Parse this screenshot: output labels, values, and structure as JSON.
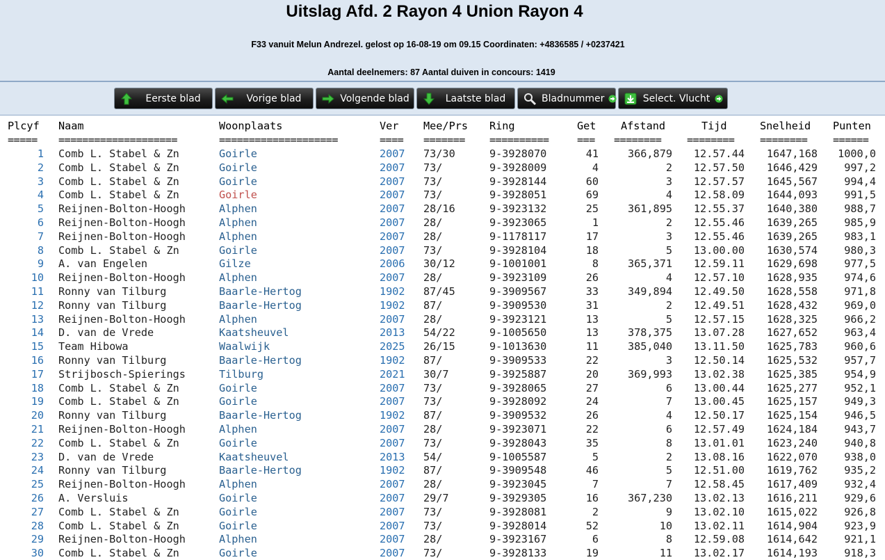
{
  "header": {
    "title": "Uitslag Afd. 2 Rayon 4 Union Rayon 4",
    "subtitle": "F33 vanuit Melun Andrezel. gelost op 16-08-19 om 09.15 Coordinaten: +4836585 / +0237421",
    "stats": "Aantal deelnemers: 87 Aantal duiven in concours: 1419"
  },
  "nav": {
    "first": "Eerste blad",
    "prev": "Vorige blad",
    "next": "Volgende blad",
    "last": "Laatste blad",
    "page": "Bladnummer",
    "select": "Select. Vlucht"
  },
  "columns": [
    "Plcyf",
    "Naam",
    "Woonplaats",
    "Ver",
    "Mee/Prs",
    "Ring",
    "Get",
    "Afstand",
    "Tijd",
    "Snelheid",
    "Punten"
  ],
  "separators": [
    "=====",
    "====================",
    "====================",
    "====",
    "=======",
    "==========",
    "===",
    "========",
    "========",
    "========",
    "======"
  ],
  "colors": {
    "link": "#2a6fb0",
    "woonplaats": "#2a6090",
    "highlight": "#c0504d",
    "header_bg": "#dde7f2"
  },
  "rows": [
    {
      "plcyf": "1",
      "naam": "Comb L. Stabel & Zn",
      "woonplaats": "Goirle",
      "ver": "2007",
      "meeprs": "73/30",
      "ring": "9-3928070",
      "get": "41",
      "afstand": "366,879",
      "tijd": "12.57.44",
      "snelheid": "1647,168",
      "punten": "1000,0"
    },
    {
      "plcyf": "2",
      "naam": "Comb L. Stabel & Zn",
      "woonplaats": "Goirle",
      "ver": "2007",
      "meeprs": "73/",
      "ring": "9-3928009",
      "get": "4",
      "afstand": "2",
      "tijd": "12.57.50",
      "snelheid": "1646,429",
      "punten": "997,2"
    },
    {
      "plcyf": "3",
      "naam": "Comb L. Stabel & Zn",
      "woonplaats": "Goirle",
      "ver": "2007",
      "meeprs": "73/",
      "ring": "9-3928144",
      "get": "60",
      "afstand": "3",
      "tijd": "12.57.57",
      "snelheid": "1645,567",
      "punten": "994,4"
    },
    {
      "plcyf": "4",
      "naam": "Comb L. Stabel & Zn",
      "woonplaats": "Goirle",
      "ver": "2007",
      "meeprs": "73/",
      "ring": "9-3928051",
      "get": "69",
      "afstand": "4",
      "tijd": "12.58.09",
      "snelheid": "1644,093",
      "punten": "991,5",
      "highlight": true
    },
    {
      "plcyf": "5",
      "naam": "Reijnen-Bolton-Hoogh",
      "woonplaats": "Alphen",
      "ver": "2007",
      "meeprs": "28/16",
      "ring": "9-3923132",
      "get": "25",
      "afstand": "361,895",
      "tijd": "12.55.37",
      "snelheid": "1640,380",
      "punten": "988,7"
    },
    {
      "plcyf": "6",
      "naam": "Reijnen-Bolton-Hoogh",
      "woonplaats": "Alphen",
      "ver": "2007",
      "meeprs": "28/",
      "ring": "9-3923065",
      "get": "1",
      "afstand": "2",
      "tijd": "12.55.46",
      "snelheid": "1639,265",
      "punten": "985,9"
    },
    {
      "plcyf": "7",
      "naam": "Reijnen-Bolton-Hoogh",
      "woonplaats": "Alphen",
      "ver": "2007",
      "meeprs": "28/",
      "ring": "9-1178117",
      "get": "17",
      "afstand": "3",
      "tijd": "12.55.46",
      "snelheid": "1639,265",
      "punten": "983,1"
    },
    {
      "plcyf": "8",
      "naam": "Comb L. Stabel & Zn",
      "woonplaats": "Goirle",
      "ver": "2007",
      "meeprs": "73/",
      "ring": "9-3928104",
      "get": "18",
      "afstand": "5",
      "tijd": "13.00.00",
      "snelheid": "1630,574",
      "punten": "980,3"
    },
    {
      "plcyf": "9",
      "naam": "A. van Engelen",
      "woonplaats": "Gilze",
      "ver": "2006",
      "meeprs": "30/12",
      "ring": "9-1001001",
      "get": "8",
      "afstand": "365,371",
      "tijd": "12.59.11",
      "snelheid": "1629,698",
      "punten": "977,5"
    },
    {
      "plcyf": "10",
      "naam": "Reijnen-Bolton-Hoogh",
      "woonplaats": "Alphen",
      "ver": "2007",
      "meeprs": "28/",
      "ring": "9-3923109",
      "get": "26",
      "afstand": "4",
      "tijd": "12.57.10",
      "snelheid": "1628,935",
      "punten": "974,6"
    },
    {
      "plcyf": "11",
      "naam": "Ronny van Tilburg",
      "woonplaats": "Baarle-Hertog",
      "ver": "1902",
      "meeprs": "87/45",
      "ring": "9-3909567",
      "get": "33",
      "afstand": "349,894",
      "tijd": "12.49.50",
      "snelheid": "1628,558",
      "punten": "971,8"
    },
    {
      "plcyf": "12",
      "naam": "Ronny van Tilburg",
      "woonplaats": "Baarle-Hertog",
      "ver": "1902",
      "meeprs": "87/",
      "ring": "9-3909530",
      "get": "31",
      "afstand": "2",
      "tijd": "12.49.51",
      "snelheid": "1628,432",
      "punten": "969,0"
    },
    {
      "plcyf": "13",
      "naam": "Reijnen-Bolton-Hoogh",
      "woonplaats": "Alphen",
      "ver": "2007",
      "meeprs": "28/",
      "ring": "9-3923121",
      "get": "13",
      "afstand": "5",
      "tijd": "12.57.15",
      "snelheid": "1628,325",
      "punten": "966,2"
    },
    {
      "plcyf": "14",
      "naam": "D. van de Vrede",
      "woonplaats": "Kaatsheuvel",
      "ver": "2013",
      "meeprs": "54/22",
      "ring": "9-1005650",
      "get": "13",
      "afstand": "378,375",
      "tijd": "13.07.28",
      "snelheid": "1627,652",
      "punten": "963,4"
    },
    {
      "plcyf": "15",
      "naam": "Team Hibowa",
      "woonplaats": "Waalwijk",
      "ver": "2025",
      "meeprs": "26/15",
      "ring": "9-1013630",
      "get": "11",
      "afstand": "385,040",
      "tijd": "13.11.50",
      "snelheid": "1625,783",
      "punten": "960,6"
    },
    {
      "plcyf": "16",
      "naam": "Ronny van Tilburg",
      "woonplaats": "Baarle-Hertog",
      "ver": "1902",
      "meeprs": "87/",
      "ring": "9-3909533",
      "get": "22",
      "afstand": "3",
      "tijd": "12.50.14",
      "snelheid": "1625,532",
      "punten": "957,7"
    },
    {
      "plcyf": "17",
      "naam": "Strijbosch-Spierings",
      "woonplaats": "Tilburg",
      "ver": "2021",
      "meeprs": "30/7",
      "ring": "9-3925887",
      "get": "20",
      "afstand": "369,993",
      "tijd": "13.02.38",
      "snelheid": "1625,385",
      "punten": "954,9"
    },
    {
      "plcyf": "18",
      "naam": "Comb L. Stabel & Zn",
      "woonplaats": "Goirle",
      "ver": "2007",
      "meeprs": "73/",
      "ring": "9-3928065",
      "get": "27",
      "afstand": "6",
      "tijd": "13.00.44",
      "snelheid": "1625,277",
      "punten": "952,1"
    },
    {
      "plcyf": "19",
      "naam": "Comb L. Stabel & Zn",
      "woonplaats": "Goirle",
      "ver": "2007",
      "meeprs": "73/",
      "ring": "9-3928092",
      "get": "24",
      "afstand": "7",
      "tijd": "13.00.45",
      "snelheid": "1625,157",
      "punten": "949,3"
    },
    {
      "plcyf": "20",
      "naam": "Ronny van Tilburg",
      "woonplaats": "Baarle-Hertog",
      "ver": "1902",
      "meeprs": "87/",
      "ring": "9-3909532",
      "get": "26",
      "afstand": "4",
      "tijd": "12.50.17",
      "snelheid": "1625,154",
      "punten": "946,5"
    },
    {
      "plcyf": "21",
      "naam": "Reijnen-Bolton-Hoogh",
      "woonplaats": "Alphen",
      "ver": "2007",
      "meeprs": "28/",
      "ring": "9-3923071",
      "get": "22",
      "afstand": "6",
      "tijd": "12.57.49",
      "snelheid": "1624,184",
      "punten": "943,7"
    },
    {
      "plcyf": "22",
      "naam": "Comb L. Stabel & Zn",
      "woonplaats": "Goirle",
      "ver": "2007",
      "meeprs": "73/",
      "ring": "9-3928043",
      "get": "35",
      "afstand": "8",
      "tijd": "13.01.01",
      "snelheid": "1623,240",
      "punten": "940,8"
    },
    {
      "plcyf": "23",
      "naam": "D. van de Vrede",
      "woonplaats": "Kaatsheuvel",
      "ver": "2013",
      "meeprs": "54/",
      "ring": "9-1005587",
      "get": "5",
      "afstand": "2",
      "tijd": "13.08.16",
      "snelheid": "1622,070",
      "punten": "938,0"
    },
    {
      "plcyf": "24",
      "naam": "Ronny van Tilburg",
      "woonplaats": "Baarle-Hertog",
      "ver": "1902",
      "meeprs": "87/",
      "ring": "9-3909548",
      "get": "46",
      "afstand": "5",
      "tijd": "12.51.00",
      "snelheid": "1619,762",
      "punten": "935,2"
    },
    {
      "plcyf": "25",
      "naam": "Reijnen-Bolton-Hoogh",
      "woonplaats": "Alphen",
      "ver": "2007",
      "meeprs": "28/",
      "ring": "9-3923045",
      "get": "7",
      "afstand": "7",
      "tijd": "12.58.45",
      "snelheid": "1617,409",
      "punten": "932,4"
    },
    {
      "plcyf": "26",
      "naam": "A. Versluis",
      "woonplaats": "Goirle",
      "ver": "2007",
      "meeprs": "29/7",
      "ring": "9-3929305",
      "get": "16",
      "afstand": "367,230",
      "tijd": "13.02.13",
      "snelheid": "1616,211",
      "punten": "929,6"
    },
    {
      "plcyf": "27",
      "naam": "Comb L. Stabel & Zn",
      "woonplaats": "Goirle",
      "ver": "2007",
      "meeprs": "73/",
      "ring": "9-3928081",
      "get": "2",
      "afstand": "9",
      "tijd": "13.02.10",
      "snelheid": "1615,022",
      "punten": "926,8"
    },
    {
      "plcyf": "28",
      "naam": "Comb L. Stabel & Zn",
      "woonplaats": "Goirle",
      "ver": "2007",
      "meeprs": "73/",
      "ring": "9-3928014",
      "get": "52",
      "afstand": "10",
      "tijd": "13.02.11",
      "snelheid": "1614,904",
      "punten": "923,9"
    },
    {
      "plcyf": "29",
      "naam": "Reijnen-Bolton-Hoogh",
      "woonplaats": "Alphen",
      "ver": "2007",
      "meeprs": "28/",
      "ring": "9-3923167",
      "get": "6",
      "afstand": "8",
      "tijd": "12.59.08",
      "snelheid": "1614,642",
      "punten": "921,1"
    },
    {
      "plcyf": "30",
      "naam": "Comb L. Stabel & Zn",
      "woonplaats": "Goirle",
      "ver": "2007",
      "meeprs": "73/",
      "ring": "9-3928133",
      "get": "19",
      "afstand": "11",
      "tijd": "13.02.17",
      "snelheid": "1614,193",
      "punten": "918,3"
    }
  ]
}
